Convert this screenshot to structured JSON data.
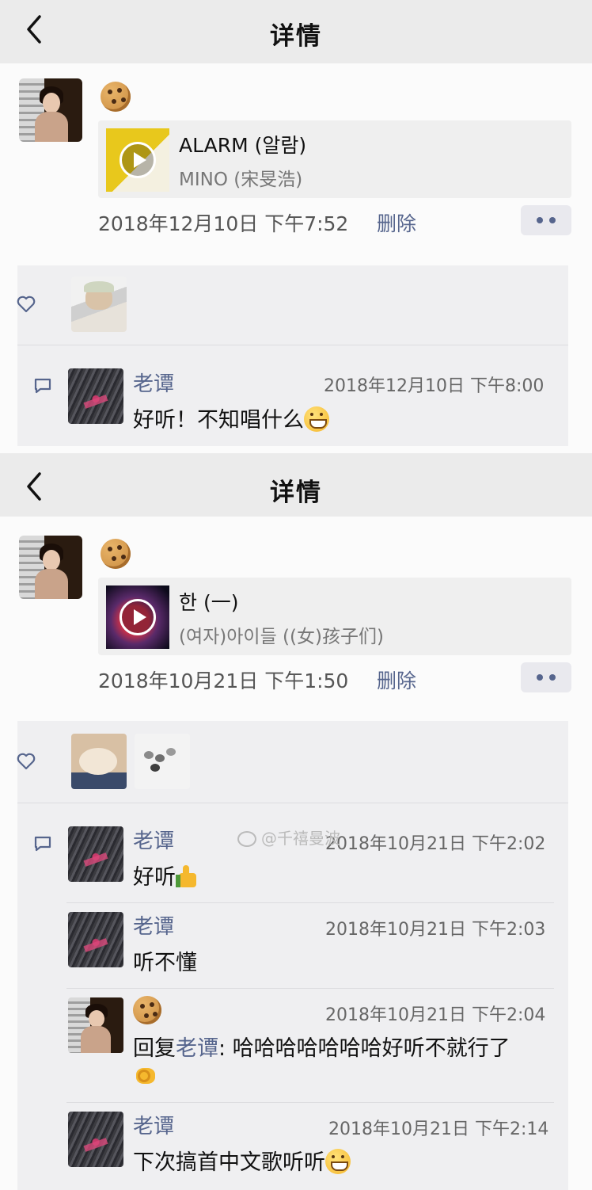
{
  "screen1": {
    "nav": {
      "title": "详情"
    },
    "post": {
      "song_title": "ALARM (알람)",
      "artist": "MINO (宋旻浩)",
      "datetime": "2018年12月10日  下午7:52",
      "delete_label": "删除"
    },
    "comments": [
      {
        "user": "老谭",
        "time": "2018年12月10日 下午8:00",
        "text": "好听！不知唱什么"
      }
    ]
  },
  "screen2": {
    "nav": {
      "title": "详情"
    },
    "post": {
      "song_title": "한 (一)",
      "artist": "(여자)아이들 ((女)孩子们)",
      "datetime": "2018年10月21日  下午1:50",
      "delete_label": "删除"
    },
    "watermark": "@千禧曼波",
    "comments": [
      {
        "user": "老谭",
        "time": "2018年10月21日 下午2:02",
        "text": "好听"
      },
      {
        "user": "老谭",
        "time": "2018年10月21日 下午2:03",
        "text": "听不懂"
      },
      {
        "time": "2018年10月21日 下午2:04",
        "reply_prefix": "回复",
        "reply_to": "老谭",
        "text": ": 哈哈哈哈哈哈哈好听不就行了"
      },
      {
        "user": "老谭",
        "time": "2018年10月21日 下午2:14",
        "text": "下次搞首中文歌听听"
      }
    ]
  },
  "colors": {
    "link": "#56658d",
    "nav_bg": "#ebebeb",
    "card_bg": "#efeff1"
  },
  "icons": [
    "back-chevron-icon",
    "cookie-emoji-icon",
    "play-icon",
    "more-dots-icon",
    "heart-icon",
    "comment-icon",
    "grin-emoji-icon",
    "thumbs-up-emoji-icon",
    "ok-hand-emoji-icon",
    "weibo-icon"
  ]
}
